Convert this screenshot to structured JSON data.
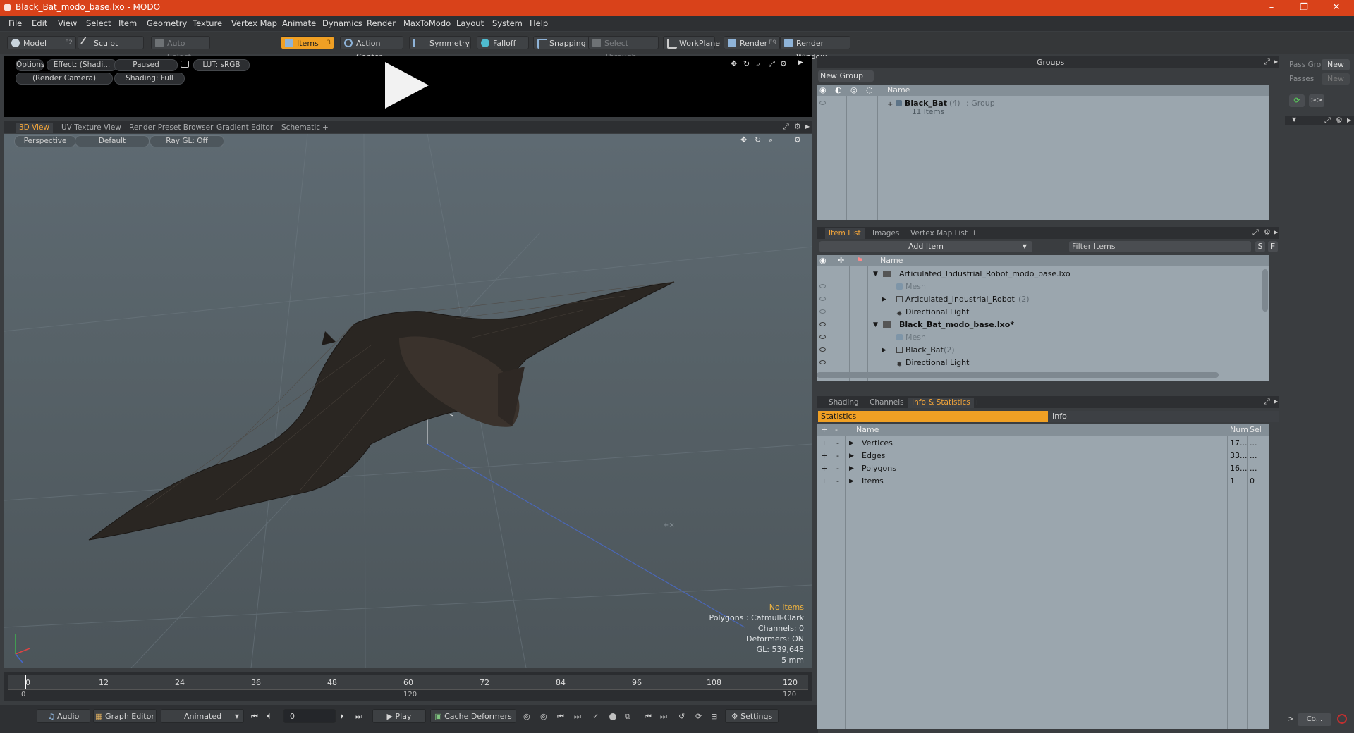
{
  "window": {
    "title": "Black_Bat_modo_base.lxo - MODO",
    "minimize": "–",
    "maximize": "❐",
    "close": "✕"
  },
  "menu": [
    "File",
    "Edit",
    "View",
    "Select",
    "Item",
    "Geometry",
    "Texture",
    "Vertex Map",
    "Animate",
    "Dynamics",
    "Render",
    "MaxToModo",
    "Layout",
    "System",
    "Help"
  ],
  "toolbar": {
    "model": "Model",
    "model_key": "F2",
    "sculpt": "Sculpt",
    "auto_select": "Auto Select",
    "items": "Items",
    "items_key": "3",
    "action_center": "Action Center",
    "symmetry": "Symmetry",
    "falloff": "Falloff",
    "snapping": "Snapping",
    "select_through": "Select Through",
    "workplane": "WorkPlane",
    "render": "Render",
    "render_key": "F9",
    "render_window": "Render Window"
  },
  "preview": {
    "options": "Options",
    "effect": "Effect: (Shadi...",
    "paused": "Paused",
    "lut": "LUT: sRGB",
    "camera": "(Render Camera)",
    "shading": "Shading: Full"
  },
  "view_tabs": [
    "3D View",
    "UV Texture View",
    "Render Preset Browser",
    "Gradient Editor",
    "Schematic",
    "+"
  ],
  "viewport": {
    "perspective": "Perspective",
    "default": "Default",
    "raygl": "Ray GL: Off",
    "stats": [
      "No Items",
      "Polygons : Catmull-Clark",
      "Channels: 0",
      "Deformers: ON",
      "GL: 539,648",
      "5 mm"
    ]
  },
  "timeline": {
    "ticks": [
      "0",
      "12",
      "24",
      "36",
      "48",
      "60",
      "72",
      "84",
      "96",
      "108",
      "120"
    ],
    "range_start": "0",
    "range_mid": "120",
    "range_end": "120"
  },
  "bottom": {
    "audio": "Audio",
    "graph_editor": "Graph Editor",
    "animated": "Animated",
    "frame": "0",
    "play": "Play",
    "cache": "Cache Deformers",
    "settings": "Settings"
  },
  "groups": {
    "title": "Groups",
    "new_group": "New Group",
    "col_name": "Name",
    "item_name": "Black_Bat",
    "item_count": "(4)",
    "item_type": ": Group",
    "item_sub": "11 Items"
  },
  "pass": {
    "label1": "Pass Gro",
    "new1": "New",
    "label2": "Passes",
    "new2": "New",
    "arrow": ">>",
    "co": "Co..."
  },
  "item_tabs": [
    "Item List",
    "Images",
    "Vertex Map List",
    "+"
  ],
  "item_list": {
    "add_item": "Add Item",
    "filter": "Filter Items",
    "s": "S",
    "f": "F",
    "col_name": "Name",
    "rows": [
      {
        "label": "Articulated_Industrial_Robot_modo_base.lxo",
        "indent": 0,
        "expanded": true,
        "dim": false,
        "bold": false
      },
      {
        "label": "Mesh",
        "indent": 2,
        "dim": true
      },
      {
        "label": "Articulated_Industrial_Robot",
        "suffix": "(2)",
        "indent": 1,
        "collapsed": true
      },
      {
        "label": "Directional Light",
        "indent": 2
      },
      {
        "label": "Black_Bat_modo_base.lxo*",
        "indent": 0,
        "expanded": true,
        "bold": true
      },
      {
        "label": "Mesh",
        "indent": 2,
        "dim": true
      },
      {
        "label": "Black_Bat",
        "suffix": "(2)",
        "indent": 1,
        "collapsed": true
      },
      {
        "label": "Directional Light",
        "indent": 2
      }
    ]
  },
  "info_tabs": [
    "Shading",
    "Channels",
    "Info & Statistics",
    "+"
  ],
  "stats": {
    "tab_statistics": "Statistics",
    "tab_info": "Info",
    "col_name": "Name",
    "col_num": "Num",
    "col_sel": "Sel",
    "rows": [
      {
        "name": "Vertices",
        "num": "17...",
        "sel": "..."
      },
      {
        "name": "Edges",
        "num": "33...",
        "sel": "..."
      },
      {
        "name": "Polygons",
        "num": "16...",
        "sel": "..."
      },
      {
        "name": "Items",
        "num": "1",
        "sel": "0"
      }
    ]
  }
}
